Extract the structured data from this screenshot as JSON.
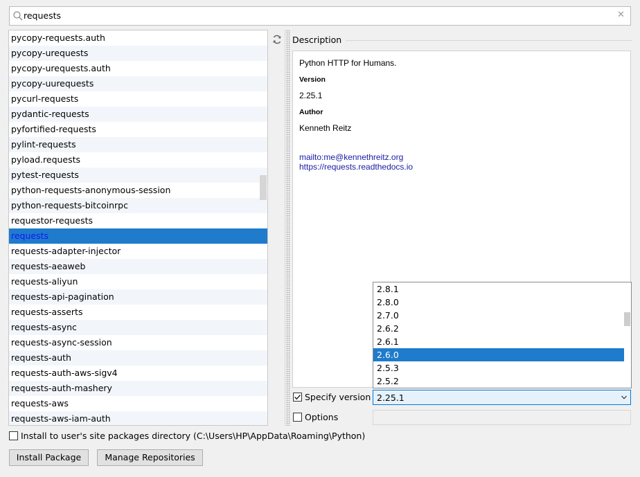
{
  "search": {
    "query": "requests",
    "clear_icon": "✕"
  },
  "packages": [
    "pycopy-requests.auth",
    "pycopy-urequests",
    "pycopy-urequests.auth",
    "pycopy-uurequests",
    "pycurl-requests",
    "pydantic-requests",
    "pyfortified-requests",
    "pylint-requests",
    "pyload.requests",
    "pytest-requests",
    "python-requests-anonymous-session",
    "python-requests-bitcoinrpc",
    "requestor-requests",
    "requests",
    "requests-adapter-injector",
    "requests-aeaweb",
    "requests-aliyun",
    "requests-api-pagination",
    "requests-asserts",
    "requests-async",
    "requests-async-session",
    "requests-auth",
    "requests-auth-aws-sigv4",
    "requests-auth-mashery",
    "requests-aws",
    "requests-aws-iam-auth"
  ],
  "selected_package": "requests",
  "description": {
    "heading": "Description",
    "summary": "Python HTTP for Humans.",
    "version_label": "Version",
    "version": "2.25.1",
    "author_label": "Author",
    "author": "Kenneth Reitz",
    "email_link": "mailto:me@kennethreitz.org",
    "homepage_link": "https://requests.readthedocs.io"
  },
  "version_dropdown": {
    "items": [
      "2.8.1",
      "2.8.0",
      "2.7.0",
      "2.6.2",
      "2.6.1",
      "2.6.0",
      "2.5.3",
      "2.5.2"
    ],
    "highlighted": "2.6.0"
  },
  "specify_version": {
    "label": "Specify version",
    "checked": true,
    "value": "2.25.1"
  },
  "options": {
    "label": "Options",
    "checked": false,
    "value": ""
  },
  "install_user": {
    "label": "Install to user's site packages directory (C:\\Users\\HP\\AppData\\Roaming\\Python)",
    "checked": false
  },
  "buttons": {
    "install": "Install Package",
    "manage": "Manage Repositories"
  },
  "colors": {
    "selection": "#1f7bcb",
    "link": "#1a1aa6",
    "focus_border": "#0078d7"
  }
}
